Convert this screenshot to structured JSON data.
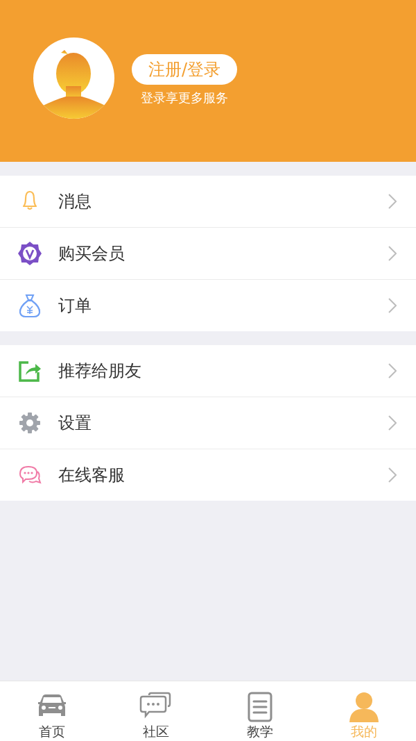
{
  "profile": {
    "login_button": "注册/登录",
    "subtitle": "登录享更多服务"
  },
  "menu_groups": [
    {
      "items": [
        {
          "kind": "bell",
          "label": "消息"
        },
        {
          "kind": "vip",
          "label": "购买会员"
        },
        {
          "kind": "moneybag",
          "label": "订单"
        }
      ]
    },
    {
      "items": [
        {
          "kind": "share",
          "label": "推荐给朋友"
        },
        {
          "kind": "gear",
          "label": "设置"
        },
        {
          "kind": "chat",
          "label": "在线客服"
        }
      ]
    }
  ],
  "tabs": [
    {
      "kind": "car",
      "label": "首页",
      "selected": false
    },
    {
      "kind": "chat",
      "label": "社区",
      "selected": false
    },
    {
      "kind": "doc",
      "label": "教学",
      "selected": false
    },
    {
      "kind": "person",
      "label": "我的",
      "selected": true
    }
  ]
}
